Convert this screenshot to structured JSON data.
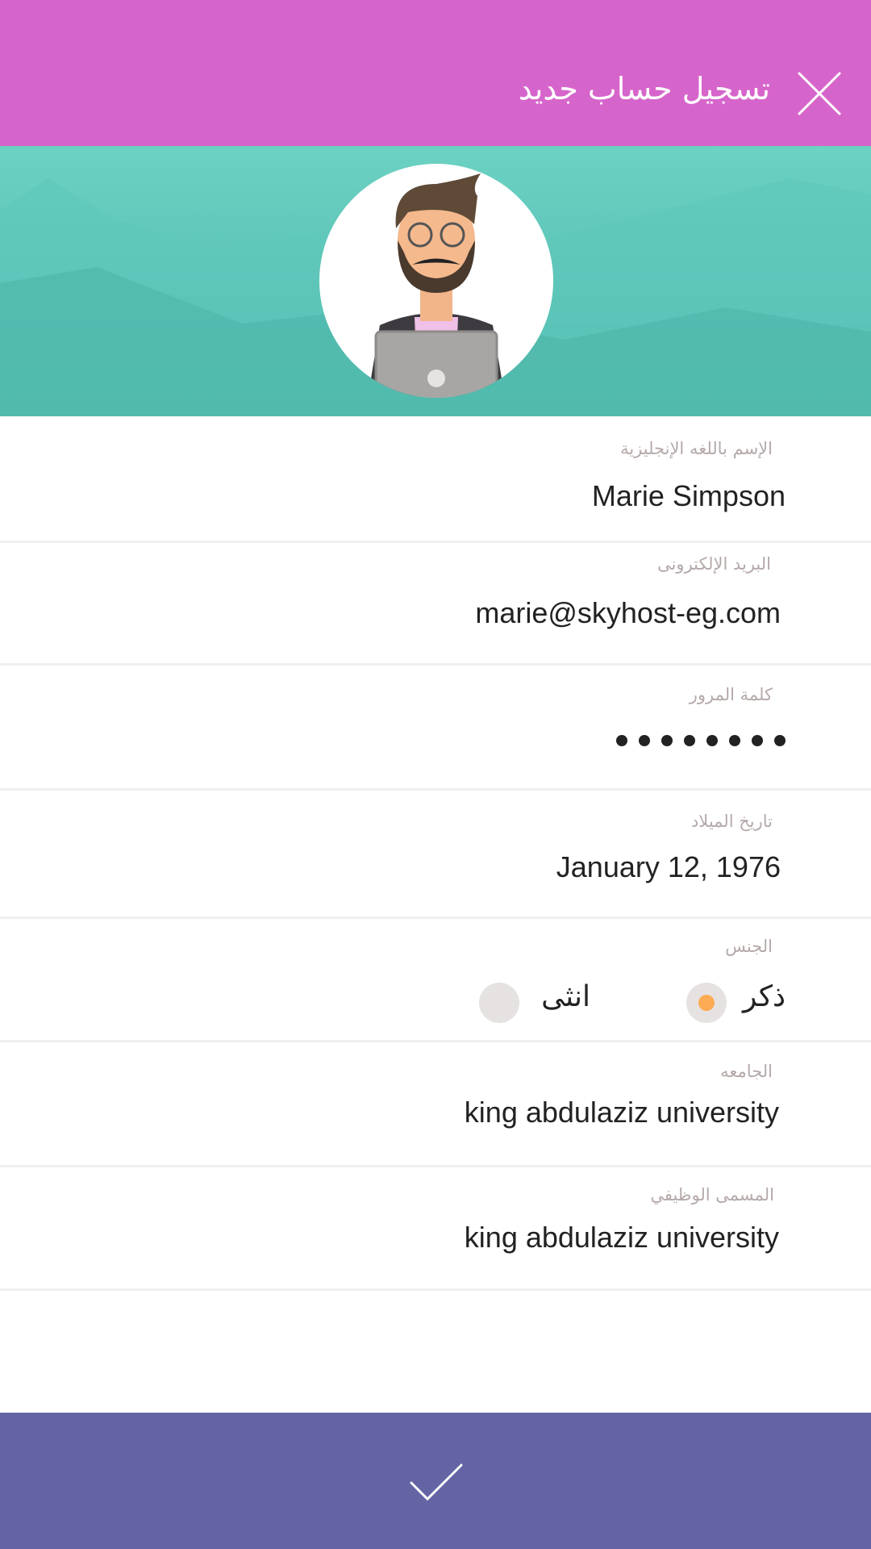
{
  "header": {
    "title": "تسجيل حساب جديد",
    "close_icon": "close-icon"
  },
  "form": {
    "name": {
      "label": "الإسم باللغه الإنجليزية",
      "value": "Marie Simpson"
    },
    "email": {
      "label": "البريد الإلكترونى",
      "value": "marie@skyhost-eg.com"
    },
    "password": {
      "label": "كلمة المرور",
      "length": 8
    },
    "birthdate": {
      "label": "تاريخ الميلاد",
      "value": "January 12, 1976"
    },
    "gender": {
      "label": "الجنس",
      "options": [
        "ذكر",
        "انثى"
      ],
      "selected": "ذكر"
    },
    "university": {
      "label": "الجامعه",
      "value": "king abdulaziz university"
    },
    "job_title": {
      "label": "المسمى الوظيفي",
      "value": "king abdulaziz university"
    }
  },
  "colors": {
    "header": "#d665cb",
    "footer": "#6464a4",
    "accent": "#fcab52"
  },
  "footer": {
    "submit_icon": "check-icon"
  }
}
